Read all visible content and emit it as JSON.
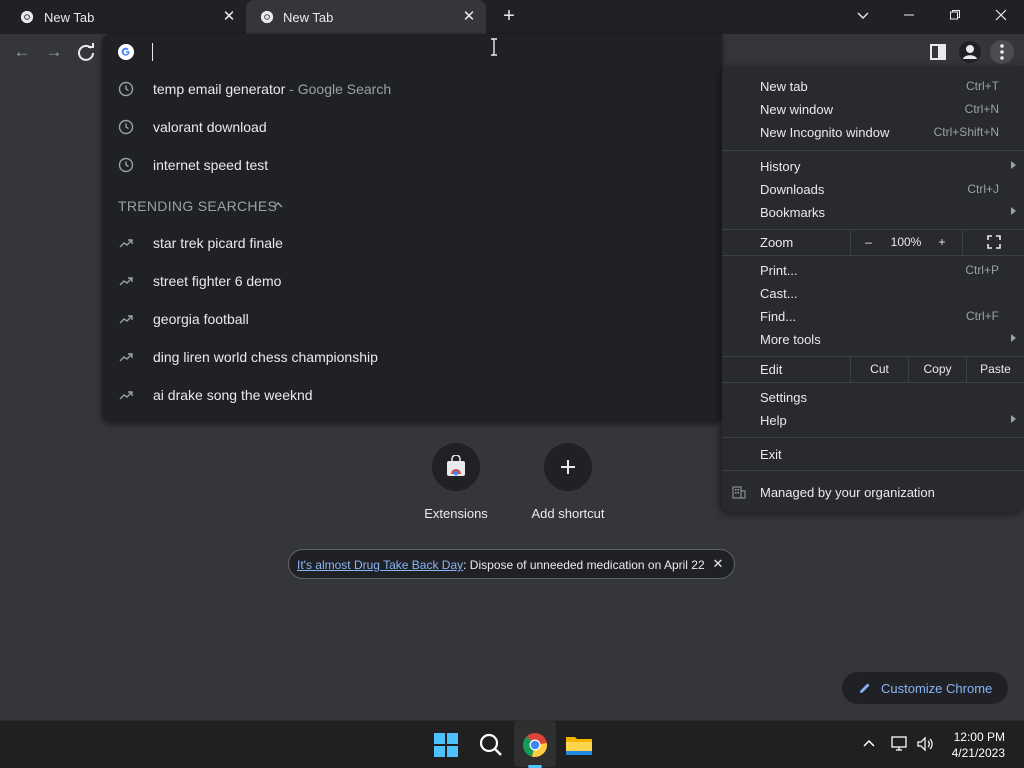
{
  "tabs": [
    {
      "title": "New Tab"
    },
    {
      "title": "New Tab"
    }
  ],
  "omnibox": {
    "suggestions": [
      {
        "text": "temp email generator",
        "suffix": " - Google Search",
        "icon": "history-icon"
      },
      {
        "text": "valorant download",
        "icon": "history-icon"
      },
      {
        "text": "internet speed test",
        "icon": "history-icon"
      }
    ],
    "trending_header": "TRENDING SEARCHES",
    "trending": [
      {
        "text": "star trek picard finale"
      },
      {
        "text": "street fighter 6 demo"
      },
      {
        "text": "georgia football"
      },
      {
        "text": "ding liren world chess championship"
      },
      {
        "text": "ai drake song the weeknd"
      }
    ]
  },
  "menu": {
    "new_tab": "New tab",
    "new_tab_short": "Ctrl+T",
    "new_window": "New window",
    "new_window_short": "Ctrl+N",
    "new_incognito": "New Incognito window",
    "new_incognito_short": "Ctrl+Shift+N",
    "history": "History",
    "downloads": "Downloads",
    "downloads_short": "Ctrl+J",
    "bookmarks": "Bookmarks",
    "zoom": "Zoom",
    "zoom_minus": "–",
    "zoom_value": "100%",
    "zoom_plus": "+",
    "print": "Print...",
    "print_short": "Ctrl+P",
    "cast": "Cast...",
    "find": "Find...",
    "find_short": "Ctrl+F",
    "more_tools": "More tools",
    "edit": "Edit",
    "cut": "Cut",
    "copy": "Copy",
    "paste": "Paste",
    "settings": "Settings",
    "help": "Help",
    "exit": "Exit",
    "managed": "Managed by your organization"
  },
  "shortcuts": [
    {
      "label": "Extensions"
    },
    {
      "label": "Add shortcut"
    }
  ],
  "promo": {
    "link": "It's almost Drug Take Back Day",
    "text": ": Dispose of unneeded medication on April 22"
  },
  "customize": {
    "label": "Customize Chrome"
  },
  "clock": {
    "time": "12:00 PM",
    "date": "4/21/2023"
  },
  "colors": {
    "accent": "#8ab4f8",
    "taskbar_indicator": "#4cc2ff"
  }
}
